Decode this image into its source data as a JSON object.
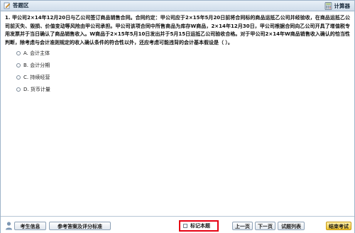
{
  "header": {
    "title": "答题区",
    "calculator_label": "计算器"
  },
  "question": {
    "text": "1. 甲公司2×14年12月20日与乙公司签订商品销售合同。合同约定：甲公司应于2×15年5月20日前将合同标的商品运抵乙公司并经验收，在商品运抵乙公司前灭失、毁损、价值变动等风险由甲公司承担。甲公司该项合同中所售商品为库存W商品，2×14年12月30日，甲公司根据合同向乙公司开具了增值税专用发票并于当日确认了商品销售收入。W商品于2×15年5月10日发出并于5月15日运抵乙公司验收合格。对于甲公司2×14年W商品销售收入确认的恰当性判断，除考虑与会计准则规定的收入确认条件的符合性以外，还应考虑可能违背的会计基本假设是（ ）。",
    "options": [
      {
        "label": "A. 会计主体"
      },
      {
        "label": "B. 会计分期"
      },
      {
        "label": "C. 持续经营"
      },
      {
        "label": "D. 货币计量"
      }
    ]
  },
  "footer": {
    "candidate_info": "考生信息",
    "reference_answer": "参考答案及评分标准",
    "mark_label": "标记本题",
    "prev": "上一页",
    "next": "下一页",
    "question_list": "试题列表",
    "end_exam": "结束考试"
  },
  "colors": {
    "highlight_border": "#e60012",
    "end_button": "#f0c430"
  }
}
